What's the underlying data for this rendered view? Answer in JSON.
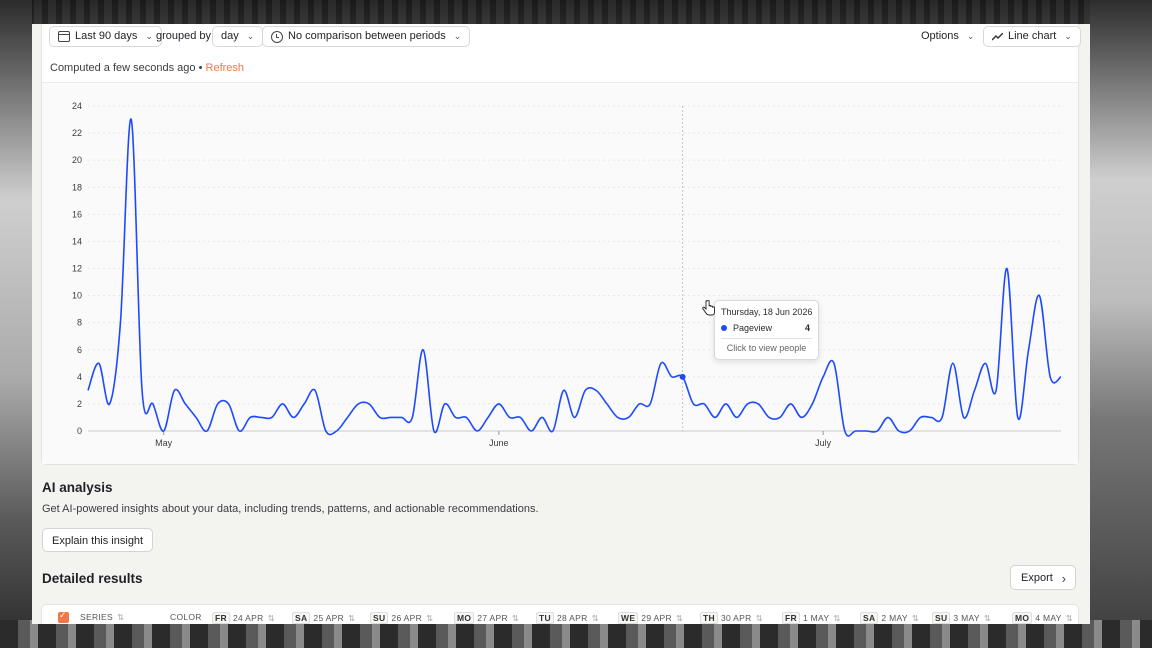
{
  "toolbar": {
    "date_range": "Last 90 days",
    "grouped_by_label": "grouped by",
    "interval": "day",
    "comparison": "No comparison between periods",
    "options_label": "Options",
    "chart_type": "Line chart"
  },
  "status": {
    "computed": "Computed a few seconds ago",
    "bullet": "•",
    "refresh": "Refresh"
  },
  "tooltip": {
    "date": "Thursday, 18 Jun 2026",
    "series": "Pageview",
    "value": "4",
    "footer": "Click to view people"
  },
  "ai": {
    "title": "AI analysis",
    "description": "Get AI-powered insights about your data, including trends, patterns, and actionable recommendations.",
    "button": "Explain this insight"
  },
  "results": {
    "title": "Detailed results",
    "export": "Export",
    "columns": [
      {
        "day": "",
        "label": "SERIES"
      },
      {
        "day": "",
        "label": "COLOR"
      },
      {
        "day": "FR",
        "label": "24 APR"
      },
      {
        "day": "SA",
        "label": "25 APR"
      },
      {
        "day": "SU",
        "label": "26 APR"
      },
      {
        "day": "MO",
        "label": "27 APR"
      },
      {
        "day": "TU",
        "label": "28 APR"
      },
      {
        "day": "WE",
        "label": "29 APR"
      },
      {
        "day": "TH",
        "label": "30 APR"
      },
      {
        "day": "FR",
        "label": "1 MAY"
      },
      {
        "day": "SA",
        "label": "2 MAY"
      },
      {
        "day": "SU",
        "label": "3 MAY"
      },
      {
        "day": "MO",
        "label": "4 MAY"
      }
    ]
  },
  "colors": {
    "accent": "#f07848",
    "series": "#1d4aff"
  },
  "chart_data": {
    "type": "line",
    "series": [
      {
        "name": "Pageview",
        "values": [
          3,
          5,
          2,
          8,
          23,
          3,
          2,
          0,
          3,
          2,
          1,
          0,
          2,
          2,
          0,
          1,
          1,
          1,
          2,
          1,
          2,
          3,
          0,
          0,
          1,
          2,
          2,
          1,
          1,
          1,
          1,
          6,
          0,
          2,
          1,
          1,
          0,
          1,
          2,
          1,
          1,
          0,
          1,
          0,
          3,
          1,
          3,
          3,
          2,
          1,
          1,
          2,
          2,
          5,
          4,
          4,
          2,
          2,
          1,
          2,
          1,
          2,
          2,
          1,
          1,
          2,
          1,
          2,
          4,
          5,
          0,
          0,
          0,
          0,
          1,
          0,
          0,
          1,
          1,
          1,
          5,
          1,
          3,
          5,
          3,
          12,
          1,
          6,
          10,
          4,
          4
        ]
      }
    ],
    "x_tick_labels": [
      "May",
      "June",
      "July"
    ],
    "y_ticks": [
      0,
      2,
      4,
      6,
      8,
      10,
      12,
      14,
      16,
      18,
      20,
      22,
      24
    ],
    "ylim": [
      0,
      24
    ],
    "grid": true,
    "highlight_index": 55
  }
}
